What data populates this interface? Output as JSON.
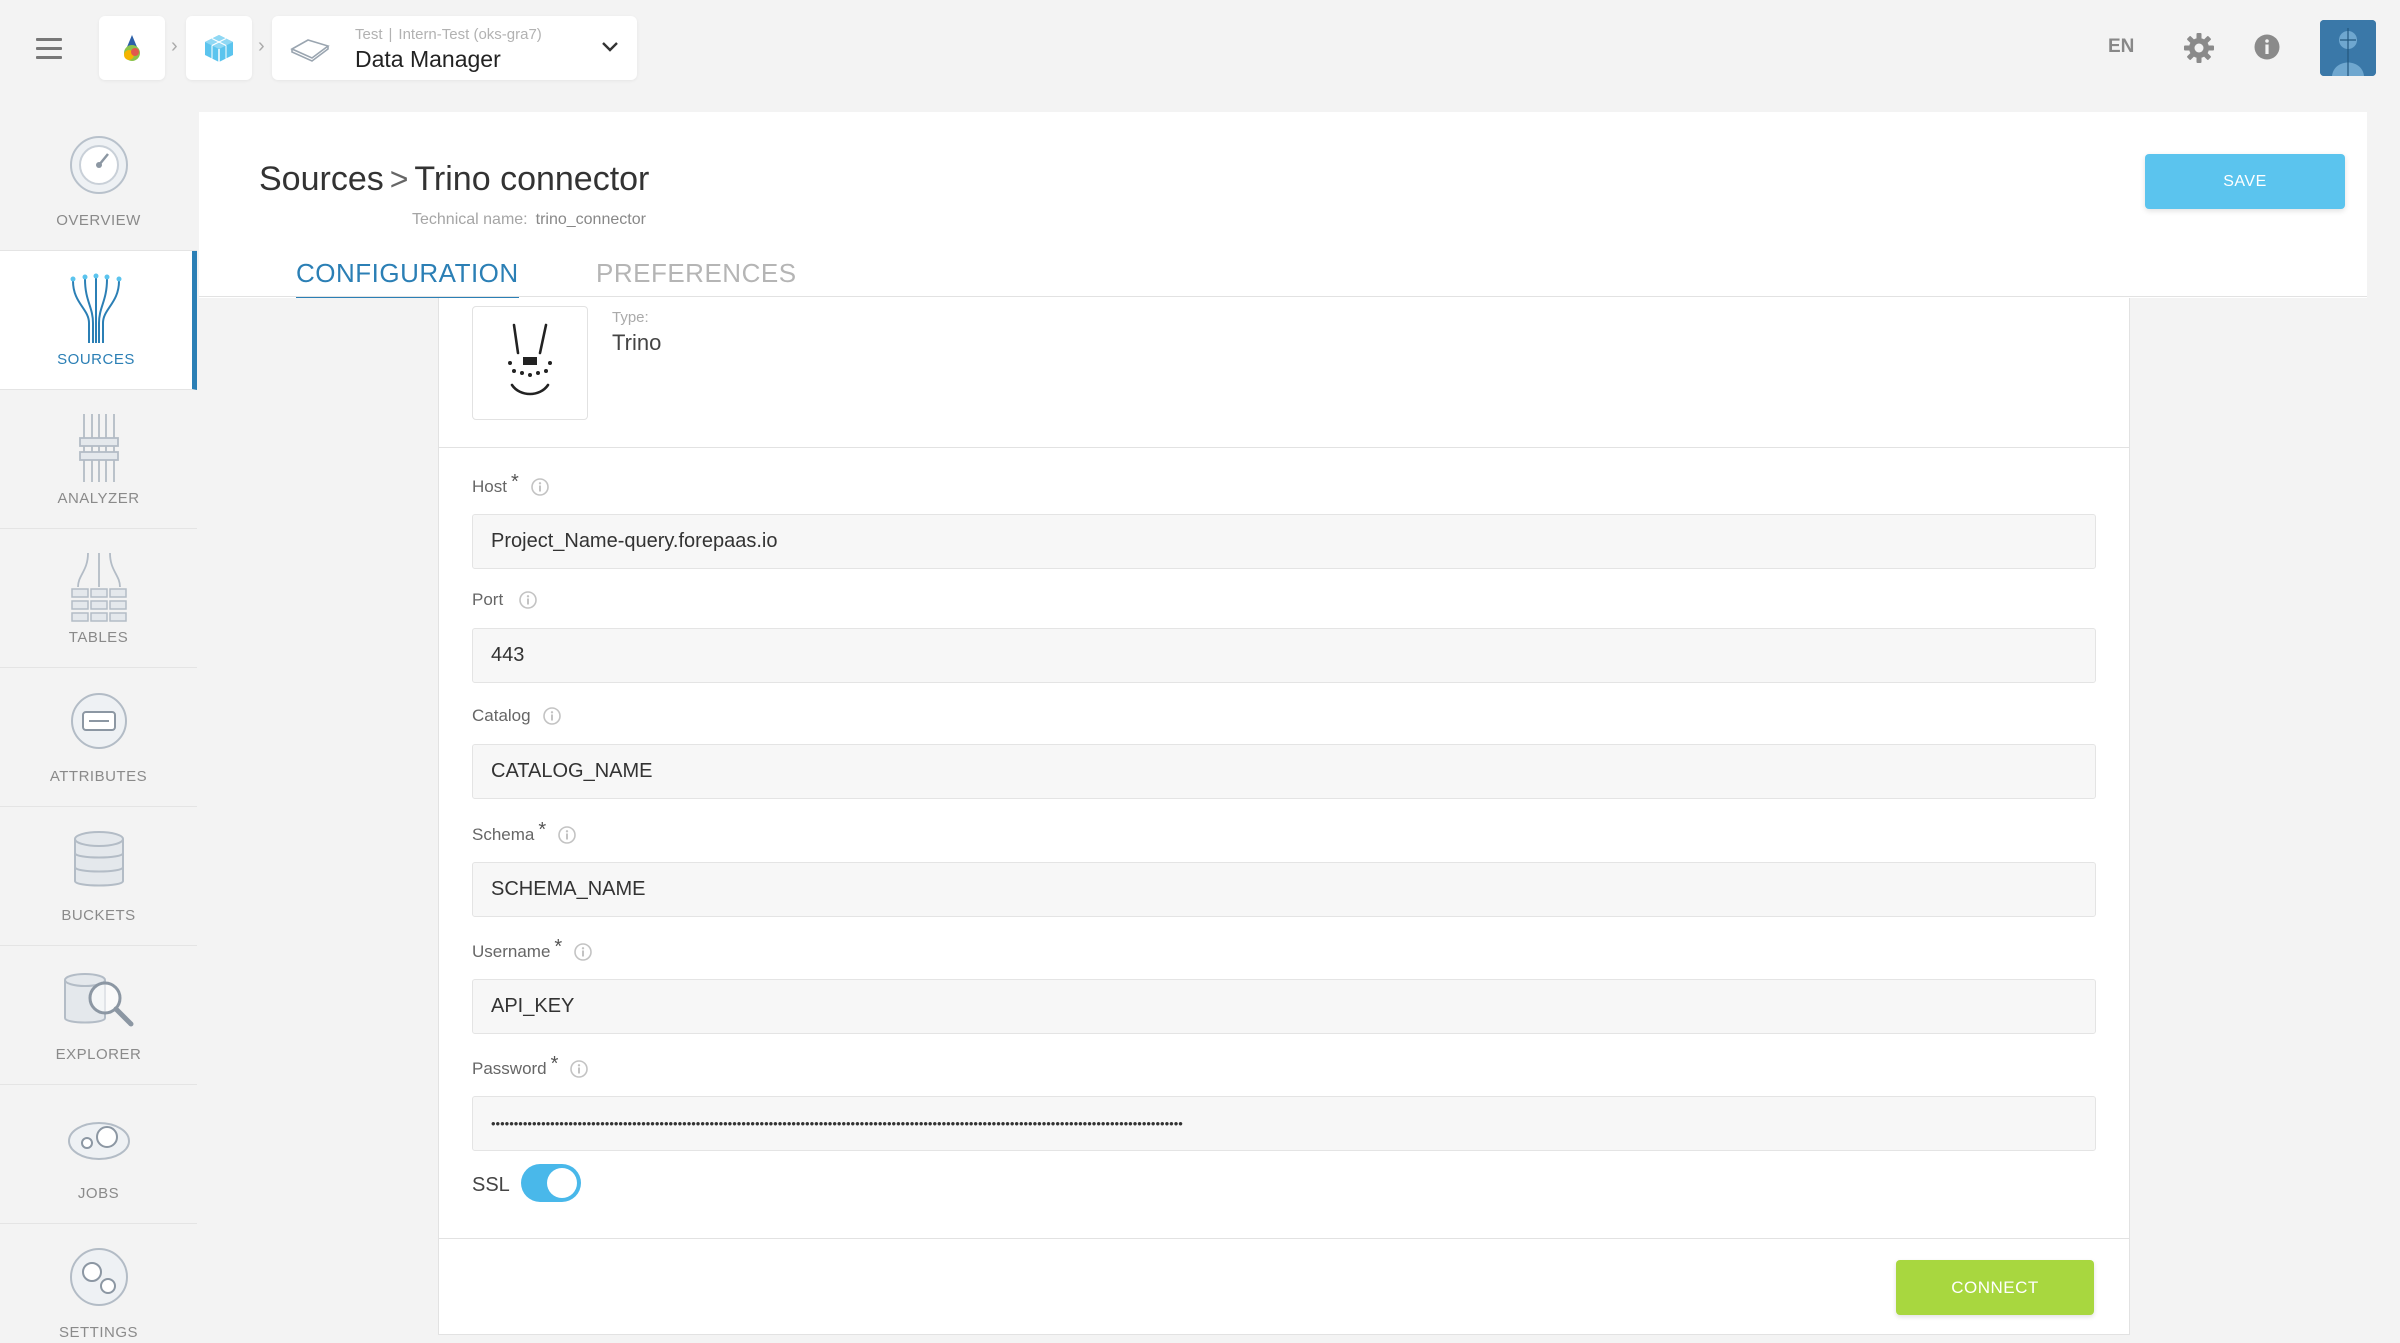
{
  "topbar": {
    "breadcrumb": {
      "env_label": "Test",
      "project_label": "Intern-Test (oks-gra7)",
      "app_title": "Data Manager"
    },
    "language": "EN"
  },
  "sidebar": {
    "items": [
      {
        "label": "OVERVIEW",
        "icon": "gauge-icon"
      },
      {
        "label": "SOURCES",
        "icon": "sources-tree-icon",
        "active": true
      },
      {
        "label": "ANALYZER",
        "icon": "analyzer-icon"
      },
      {
        "label": "TABLES",
        "icon": "tables-icon"
      },
      {
        "label": "ATTRIBUTES",
        "icon": "attributes-icon"
      },
      {
        "label": "BUCKETS",
        "icon": "database-icon"
      },
      {
        "label": "EXPLORER",
        "icon": "explorer-search-icon"
      },
      {
        "label": "JOBS",
        "icon": "jobs-icon"
      },
      {
        "label": "SETTINGS",
        "icon": "settings-gears-icon"
      }
    ]
  },
  "header": {
    "breadcrumb_root": "Sources",
    "title": "Trino connector",
    "technical_name_label": "Technical name:",
    "technical_name": "trino_connector",
    "save_label": "SAVE",
    "tabs": [
      {
        "label": "CONFIGURATION",
        "active": true
      },
      {
        "label": "PREFERENCES"
      }
    ]
  },
  "form": {
    "type_label": "Type:",
    "type_value": "Trino",
    "fields": [
      {
        "label": "Host",
        "required": true,
        "value": "Project_Name-query.forepaas.io"
      },
      {
        "label": "Port",
        "required": false,
        "value": "443"
      },
      {
        "label": "Catalog",
        "required": false,
        "value": "CATALOG_NAME"
      },
      {
        "label": "Schema",
        "required": true,
        "value": "SCHEMA_NAME"
      },
      {
        "label": "Username",
        "required": true,
        "value": "API_KEY"
      },
      {
        "label": "Password",
        "required": true,
        "value": "••••••••••••••••••••••••••••••••••••••••••••••••••••••••••••••••••••••••••••••••••••••••••••••••••••••••••••••••••••••••••••••••••••••••••••••••••••••••"
      }
    ],
    "required_marker": "*",
    "ssl_label": "SSL",
    "ssl_enabled": true,
    "connect_label": "CONNECT"
  },
  "colors": {
    "accent": "#2b7fb5",
    "save_button": "#5bc4ee",
    "connect_button": "#a8d73f",
    "toggle_on": "#49b8ea"
  }
}
